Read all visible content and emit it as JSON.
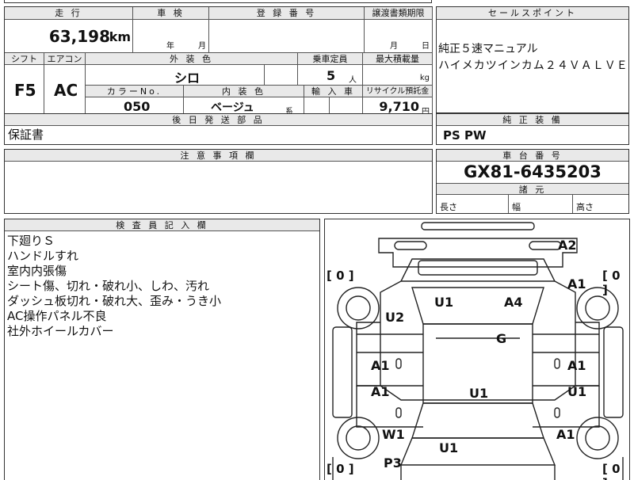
{
  "headers": {
    "mileage": "走 行",
    "inspection": "車 検",
    "registration_no": "登 録 番 号",
    "transfer_deadline": "譲渡書類期限",
    "sales_points": "セールスポイント",
    "shift": "シフト",
    "ac": "エアコン",
    "exterior_color": "外 装 色",
    "capacity": "乗車定員",
    "max_load": "最大積載量",
    "color_no": "カラーNo.",
    "interior_color": "内 装 色",
    "import": "輸 入 車",
    "recycle": "リサイクル預託金",
    "later_delivery": "後 日 発 送 部 品",
    "genuine_equipment": "純 正 装 備",
    "notes": "注 意 事 項 欄",
    "chassis_no": "車 台 番 号",
    "dimensions": "諸 元",
    "inspector_notes": "検 査 員 記 入 欄"
  },
  "values": {
    "mileage": "63,198",
    "mileage_unit": "km",
    "year_unit": "年",
    "month_unit": "月",
    "transfer_month_unit": "月",
    "transfer_day_unit": "日",
    "shift": "F5",
    "ac": "AC",
    "exterior_color": "シロ",
    "capacity": "5",
    "capacity_unit": "人",
    "load_unit": "kg",
    "color_no": "050",
    "interior_color": "ベージュ",
    "interior_suffix": "系",
    "recycle_fee": "9,710",
    "recycle_unit": "円",
    "later_delivery": "保証書",
    "genuine_equipment": "PS PW",
    "chassis_no": "GX81-6435203",
    "length_label": "長さ",
    "width_label": "幅",
    "height_label": "高さ"
  },
  "sales_points": [
    "純正５速マニュアル",
    "ハイメカツインカム２４ＶＡＬＶＥ"
  ],
  "inspector_notes": [
    "下廻りＳ",
    "ハンドルすれ",
    "室内内張傷",
    "シート傷、切れ・破れ小、しわ、汚れ",
    "ダッシュ板切れ・破れ大、歪み・うき小",
    "AC操作パネル不良",
    "社外ホイールカバー"
  ],
  "diagram": {
    "marks": {
      "A2": "A2",
      "A1_pillar_r": "A1",
      "U1_fl": "U1",
      "A4": "A4",
      "U2": "U2",
      "G": "G",
      "A1_door_fl": "A1",
      "A1_door_fr": "A1",
      "A1_door_rl": "A1",
      "U1_door_rr": "U1",
      "U1_roof": "U1",
      "W1": "W1",
      "A1_rear_r": "A1",
      "U1_rear": "U1",
      "P3": "P3"
    },
    "tire_brackets": {
      "fl": "[ 0 ]",
      "fr": "[ 0 ]",
      "rl": "[ 0 ]",
      "rr": "[ 0 ]"
    }
  }
}
